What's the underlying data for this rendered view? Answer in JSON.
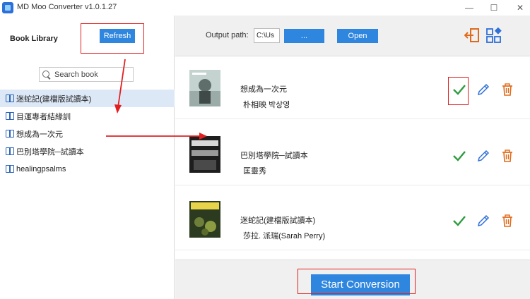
{
  "window": {
    "title": "MD Moo Converter v1.0.1.27",
    "minimize": "—",
    "maximize": "☐",
    "close": "✕"
  },
  "sidebar": {
    "title": "Book Library",
    "refresh_label": "Refresh",
    "search_placeholder": "Search book",
    "items": [
      {
        "label": "迷蛇記(建檔版試讀本)",
        "selected": true
      },
      {
        "label": "目運專者結緣訓",
        "selected": false
      },
      {
        "label": "想成為一次元",
        "selected": false
      },
      {
        "label": "巴別塔學院─試讀本",
        "selected": false
      },
      {
        "label": "healingpsalms",
        "selected": false
      }
    ]
  },
  "toolbar": {
    "output_label": "Output path:",
    "output_value": "C:\\Us",
    "browse_label": "...",
    "open_label": "Open"
  },
  "books": [
    {
      "title": "想成為一次元",
      "author": "朴相映 박상영",
      "cover_color": "#b8c9c8"
    },
    {
      "title": "巴別塔學院─試讀本",
      "author": "匡靈秀",
      "cover_color": "#2a2a2a"
    },
    {
      "title": "迷蛇記(建檔版試讀本)",
      "author": "莎拉. 派瑞(Sarah Perry)",
      "cover_color": "#3a4a2a"
    }
  ],
  "bottom": {
    "start_label": "Start Conversion"
  },
  "colors": {
    "accent": "#2f86df",
    "check": "#2e9b3e",
    "edit": "#2f6fd8",
    "trash": "#e06a1a",
    "annotation": "#e02020"
  }
}
